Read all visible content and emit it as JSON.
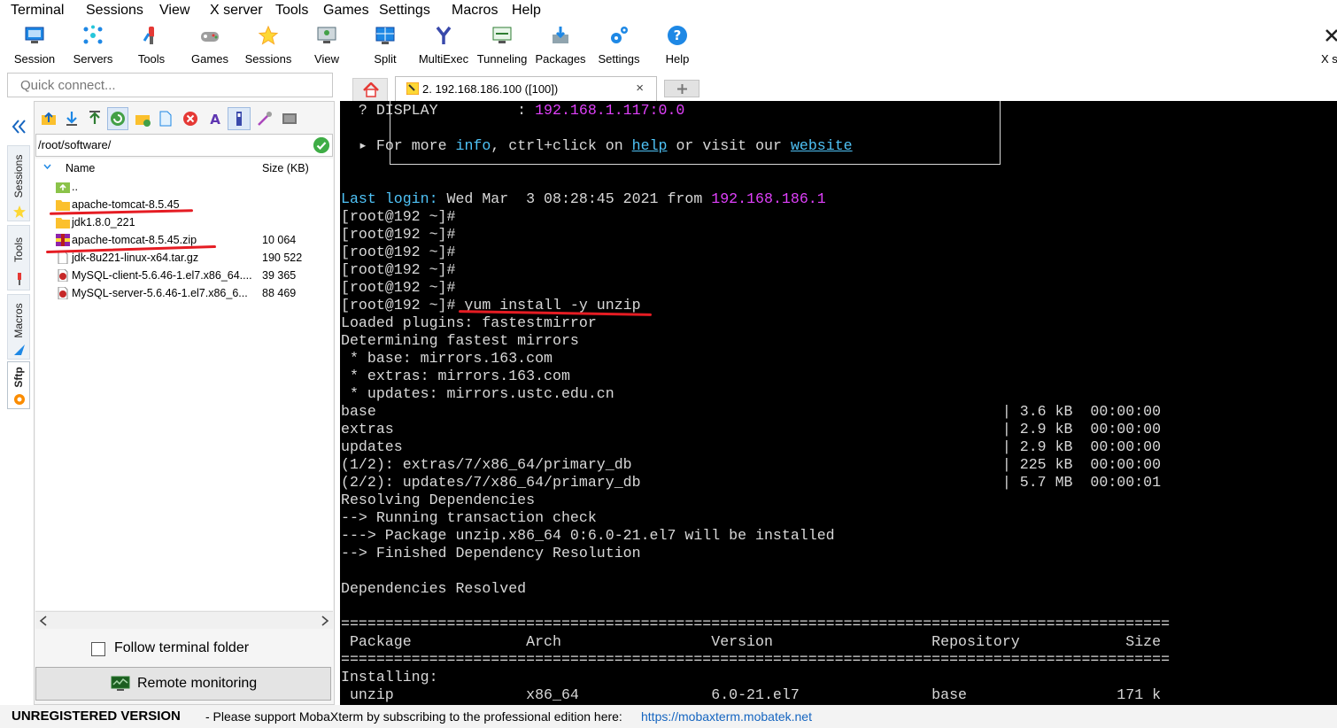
{
  "menubar": [
    "Terminal",
    "Sessions",
    "View",
    "X server",
    "Tools",
    "Games",
    "Settings",
    "Macros",
    "Help"
  ],
  "toolbar": [
    {
      "label": "Session",
      "icon": "session-icon"
    },
    {
      "label": "Servers",
      "icon": "servers-icon"
    },
    {
      "label": "Tools",
      "icon": "tools-icon"
    },
    {
      "label": "Games",
      "icon": "games-icon"
    },
    {
      "label": "Sessions",
      "icon": "star-icon"
    },
    {
      "label": "View",
      "icon": "view-icon"
    },
    {
      "label": "Split",
      "icon": "split-icon"
    },
    {
      "label": "MultiExec",
      "icon": "multiexec-icon"
    },
    {
      "label": "Tunneling",
      "icon": "tunneling-icon"
    },
    {
      "label": "Packages",
      "icon": "packages-icon"
    },
    {
      "label": "Settings",
      "icon": "settings-icon"
    },
    {
      "label": "Help",
      "icon": "help-icon"
    },
    {
      "label": "X s",
      "icon": "close-icon"
    }
  ],
  "quick_connect": {
    "placeholder": "Quick connect..."
  },
  "tabs": {
    "session_label": "2. 192.168.186.100 ([100])",
    "close": "×"
  },
  "side_tabs": [
    "Sessions",
    "Tools",
    "Macros",
    "Sftp"
  ],
  "sftp": {
    "path": "/root/software/",
    "columns": {
      "name": "Name",
      "size": "Size (KB)"
    },
    "files": [
      {
        "name": "..",
        "size": "",
        "type": "parent"
      },
      {
        "name": "apache-tomcat-8.5.45",
        "size": "",
        "type": "folder"
      },
      {
        "name": "jdk1.8.0_221",
        "size": "",
        "type": "folder"
      },
      {
        "name": "apache-tomcat-8.5.45.zip",
        "size": "10 064",
        "type": "zip"
      },
      {
        "name": "jdk-8u221-linux-x64.tar.gz",
        "size": "190 522",
        "type": "file"
      },
      {
        "name": "MySQL-client-5.6.46-1.el7.x86_64....",
        "size": "39 365",
        "type": "rpm"
      },
      {
        "name": "MySQL-server-5.6.46-1.el7.x86_6...",
        "size": "88 469",
        "type": "rpm"
      }
    ],
    "follow_label": "Follow terminal folder",
    "remote_label": "Remote monitoring"
  },
  "terminal": {
    "lines": [
      [
        {
          "t": "  ? DISPLAY         : "
        },
        {
          "t": "192.168.1.117:0.0",
          "c": "mg"
        }
      ],
      [],
      [
        {
          "t": "  ▸ For more "
        },
        {
          "t": "info",
          "c": "cy"
        },
        {
          "t": ", ctrl+click on "
        },
        {
          "t": "help",
          "c": "cy ul"
        },
        {
          "t": " or visit our "
        },
        {
          "t": "website",
          "c": "cy ul"
        }
      ],
      [],
      [],
      [
        {
          "t": "Last login:",
          "c": "cy"
        },
        {
          "t": " Wed Mar  3 08:28:45 2021 from "
        },
        {
          "t": "192.168.186.1",
          "c": "mg"
        }
      ],
      [
        {
          "t": "[root@192 ~]#"
        }
      ],
      [
        {
          "t": "[root@192 ~]#"
        }
      ],
      [
        {
          "t": "[root@192 ~]#"
        }
      ],
      [
        {
          "t": "[root@192 ~]#"
        }
      ],
      [
        {
          "t": "[root@192 ~]#"
        }
      ],
      [
        {
          "t": "[root@192 ~]# yum install -y unzip"
        }
      ],
      [
        {
          "t": "Loaded plugins: fastestmirror"
        }
      ],
      [
        {
          "t": "Determining fastest mirrors"
        }
      ],
      [
        {
          "t": " * base: mirrors.163.com"
        }
      ],
      [
        {
          "t": " * extras: mirrors.163.com"
        }
      ],
      [
        {
          "t": " * updates: mirrors.ustc.edu.cn"
        }
      ],
      [
        {
          "t": "base                                                                       | 3.6 kB  00:00:00"
        }
      ],
      [
        {
          "t": "extras                                                                     | 2.9 kB  00:00:00"
        }
      ],
      [
        {
          "t": "updates                                                                    | 2.9 kB  00:00:00"
        }
      ],
      [
        {
          "t": "(1/2): extras/7/x86_64/primary_db                                          | 225 kB  00:00:00"
        }
      ],
      [
        {
          "t": "(2/2): updates/7/x86_64/primary_db                                         | 5.7 MB  00:00:01"
        }
      ],
      [
        {
          "t": "Resolving Dependencies"
        }
      ],
      [
        {
          "t": "--> Running transaction check"
        }
      ],
      [
        {
          "t": "---> Package unzip.x86_64 0:6.0-21.el7 will be installed"
        }
      ],
      [
        {
          "t": "--> Finished Dependency Resolution"
        }
      ],
      [],
      [
        {
          "t": "Dependencies Resolved"
        }
      ],
      [],
      [
        {
          "t": "=============================================================================================="
        }
      ],
      [
        {
          "t": " Package             Arch                 Version                  Repository            Size"
        }
      ],
      [
        {
          "t": "=============================================================================================="
        }
      ],
      [
        {
          "t": "Installing:"
        }
      ],
      [
        {
          "t": " unzip               x86_64               6.0-21.el7               base                 171 k"
        }
      ]
    ]
  },
  "status": {
    "unregistered": "UNREGISTERED VERSION",
    "message": "-  Please support MobaXterm by subscribing to the professional edition here:",
    "link": "https://mobaxterm.mobatek.net"
  },
  "colors": {
    "terminal_bg": "#000000",
    "cyan": "#4fc3f7",
    "magenta": "#e040fb",
    "annotation_red": "#e51c23"
  }
}
